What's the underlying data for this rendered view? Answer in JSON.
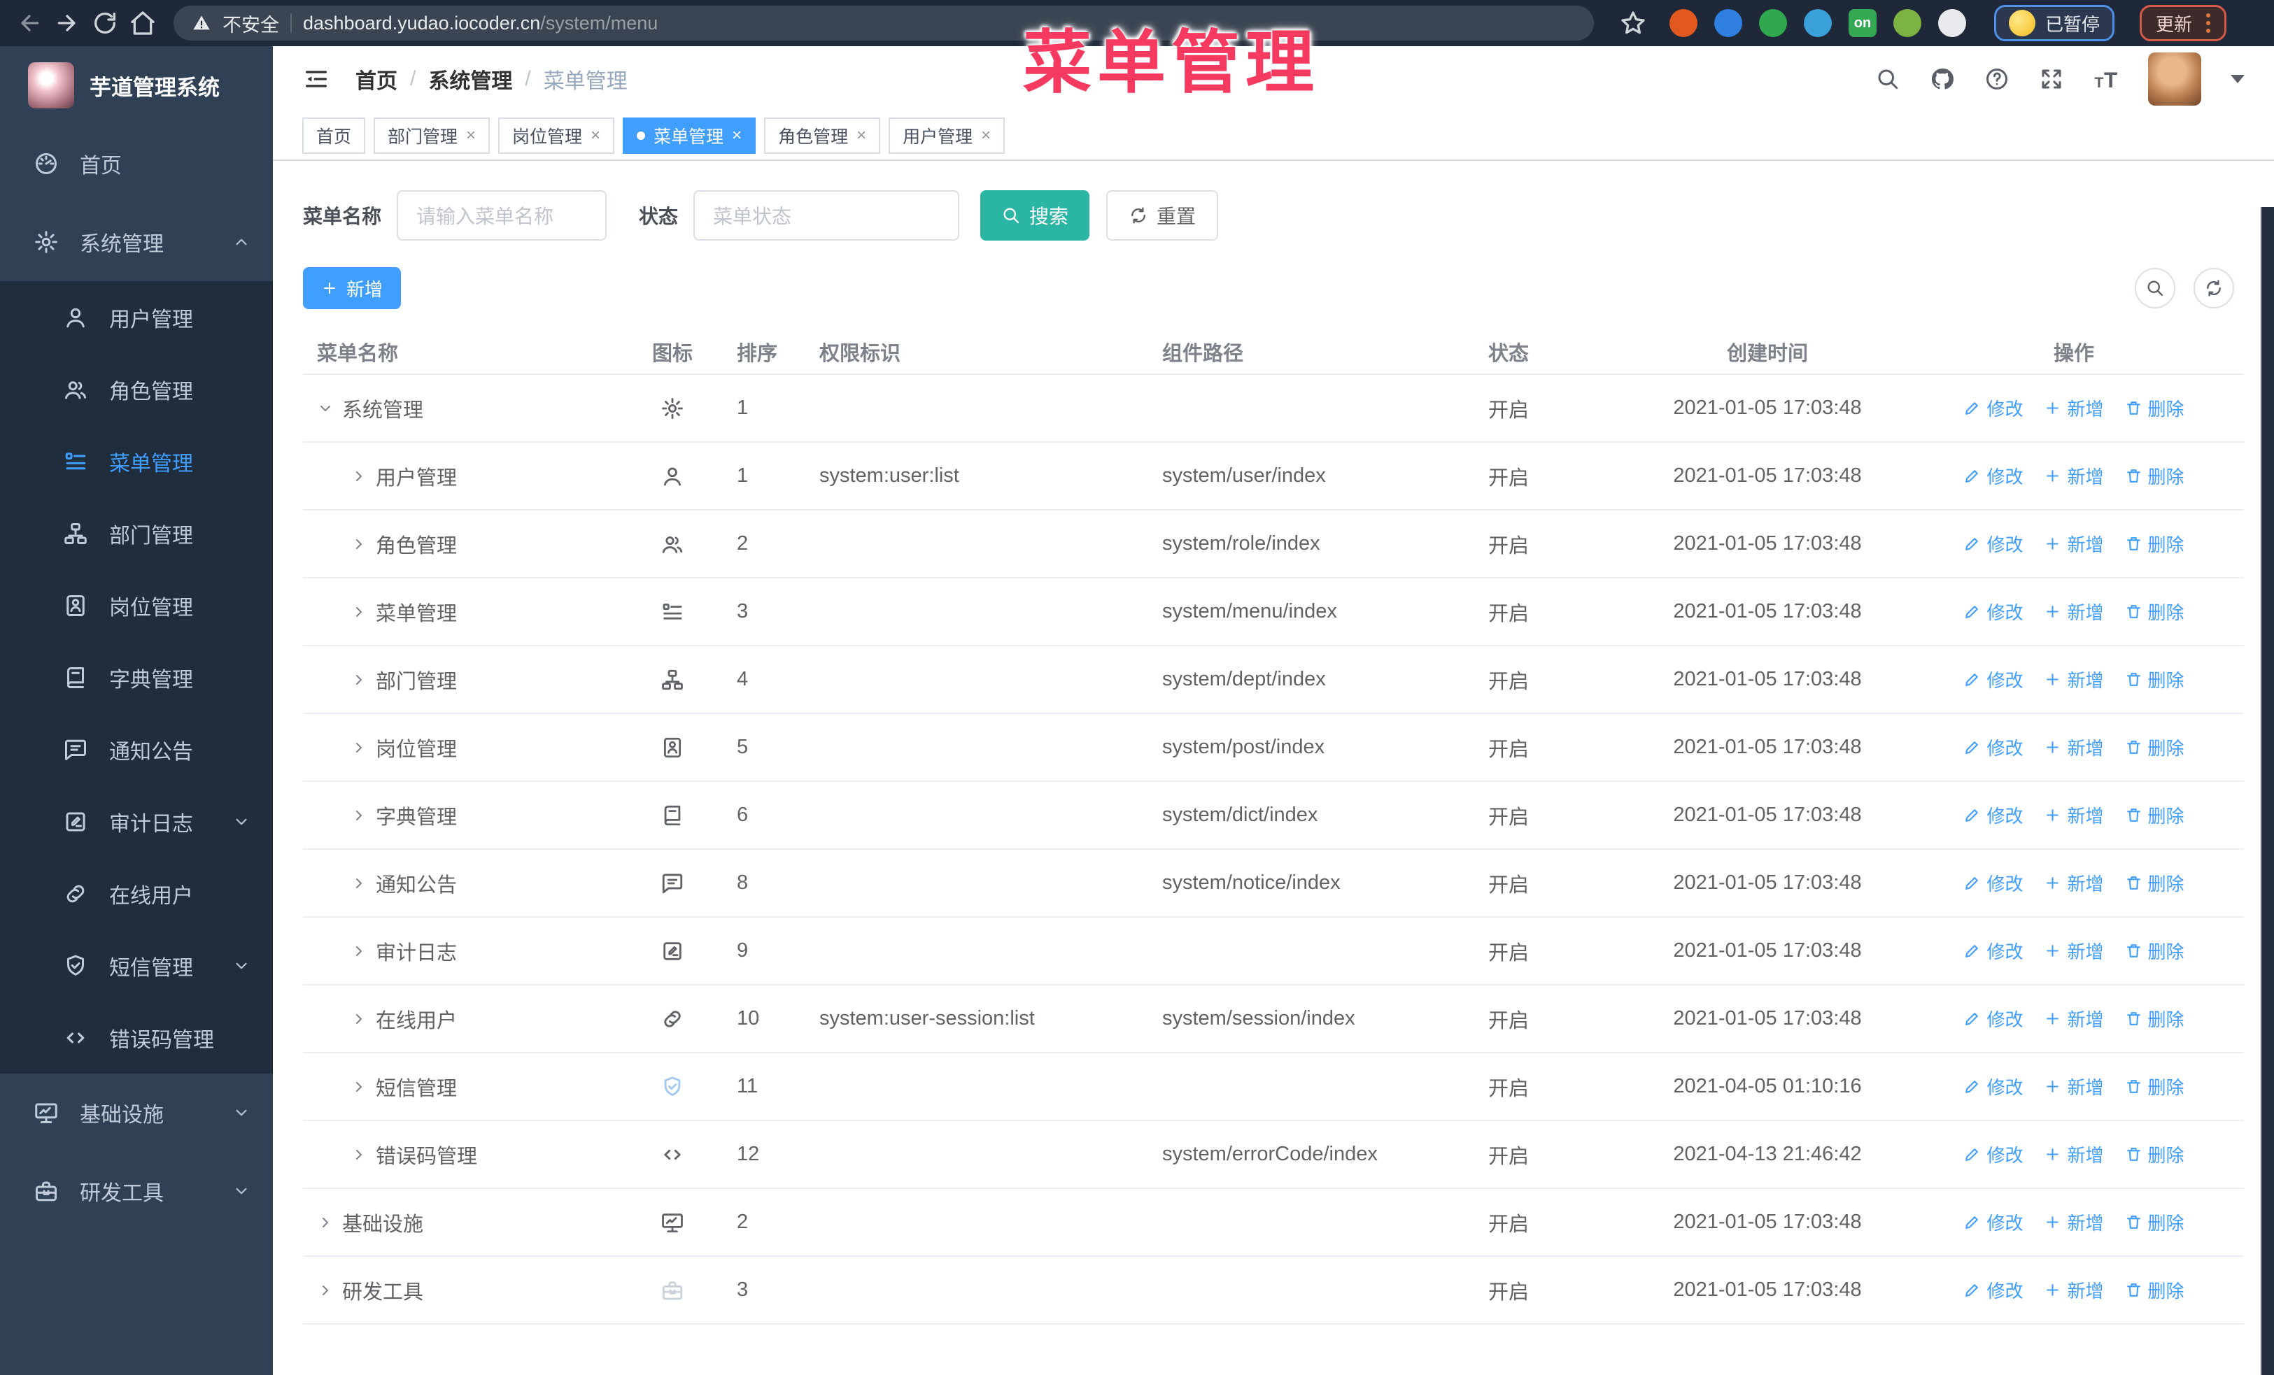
{
  "colors": {
    "accent": "#409EFF",
    "search_button": "#2BB5A5",
    "annotation": "#F5395F",
    "sidebar_bg": "#304156",
    "submenu_bg": "#1F2D3D",
    "browser_bar_bg": "#1F2838"
  },
  "annotation": {
    "text": "菜单管理"
  },
  "browser": {
    "security_label": "不安全",
    "url_host": "dashboard.yudao.iocoder.cn",
    "url_path": "/system/menu",
    "paused_label": "已暂停",
    "update_label": "更新",
    "extensions": [
      {
        "name": "extension-orange-circle-icon",
        "color": "#e2591f"
      },
      {
        "name": "extension-blue-gem-icon",
        "color": "#2f7fe0"
      },
      {
        "name": "extension-green-check-icon",
        "color": "#2fa84f"
      },
      {
        "name": "extension-blue-grid-icon",
        "color": "#3aa0d8"
      },
      {
        "name": "extension-on-badge-icon",
        "color": "#34a853",
        "label": "on"
      },
      {
        "name": "extension-green-tool-icon",
        "color": "#7cb342"
      },
      {
        "name": "extension-white-puzzle-icon",
        "color": "#e8eaed"
      }
    ]
  },
  "sidebar": {
    "title": "芋道管理系统",
    "items": [
      {
        "key": "home",
        "label": "首页",
        "icon": "dashboard-icon",
        "type": "root"
      },
      {
        "key": "system-management",
        "label": "系统管理",
        "icon": "gear-icon",
        "type": "root",
        "chevron": "up"
      },
      {
        "key": "user-management",
        "label": "用户管理",
        "icon": "user-icon",
        "type": "child"
      },
      {
        "key": "role-management",
        "label": "角色管理",
        "icon": "users-icon",
        "type": "child"
      },
      {
        "key": "menu-management",
        "label": "菜单管理",
        "icon": "menu-list-icon",
        "type": "child",
        "active": true
      },
      {
        "key": "dept-management",
        "label": "部门管理",
        "icon": "org-tree-icon",
        "type": "child"
      },
      {
        "key": "post-management",
        "label": "岗位管理",
        "icon": "id-badge-icon",
        "type": "child"
      },
      {
        "key": "dict-management",
        "label": "字典管理",
        "icon": "book-icon",
        "type": "child"
      },
      {
        "key": "notice",
        "label": "通知公告",
        "icon": "message-icon",
        "type": "child"
      },
      {
        "key": "audit-log",
        "label": "审计日志",
        "icon": "edit-note-icon",
        "type": "child",
        "chevron": "down"
      },
      {
        "key": "online-user",
        "label": "在线用户",
        "icon": "link-icon",
        "type": "child"
      },
      {
        "key": "sms-management",
        "label": "短信管理",
        "icon": "shield-check-icon",
        "type": "child",
        "chevron": "down"
      },
      {
        "key": "error-code",
        "label": "错误码管理",
        "icon": "code-icon",
        "type": "child"
      },
      {
        "key": "infrastructure",
        "label": "基础设施",
        "icon": "monitor-icon",
        "type": "root",
        "chevron": "down"
      },
      {
        "key": "dev-tools",
        "label": "研发工具",
        "icon": "toolbox-icon",
        "type": "root",
        "chevron": "down"
      }
    ]
  },
  "header": {
    "breadcrumb": [
      "首页",
      "系统管理",
      "菜单管理"
    ],
    "separator": "/"
  },
  "tabs": [
    {
      "key": "home",
      "label": "首页",
      "closable": false,
      "active": false
    },
    {
      "key": "dept",
      "label": "部门管理",
      "closable": true,
      "active": false
    },
    {
      "key": "post",
      "label": "岗位管理",
      "closable": true,
      "active": false
    },
    {
      "key": "menu",
      "label": "菜单管理",
      "closable": true,
      "active": true
    },
    {
      "key": "role",
      "label": "角色管理",
      "closable": true,
      "active": false
    },
    {
      "key": "user",
      "label": "用户管理",
      "closable": true,
      "active": false
    }
  ],
  "filters": {
    "name_label": "菜单名称",
    "name_placeholder": "请输入菜单名称",
    "status_label": "状态",
    "status_placeholder": "菜单状态",
    "search_label": "搜索",
    "reset_label": "重置"
  },
  "toolbar": {
    "add_label": "新增"
  },
  "table": {
    "columns": [
      "菜单名称",
      "图标",
      "排序",
      "权限标识",
      "组件路径",
      "状态",
      "创建时间",
      "操作"
    ],
    "ops": {
      "edit": "修改",
      "add": "新增",
      "delete": "删除"
    },
    "rows": [
      {
        "key": "system",
        "name": "系统管理",
        "icon": "gear-icon",
        "sort": "1",
        "perm": "",
        "path": "",
        "status": "开启",
        "time": "2021-01-05 17:03:48",
        "level": 0,
        "expanded": true
      },
      {
        "key": "user",
        "name": "用户管理",
        "icon": "user-icon",
        "sort": "1",
        "perm": "system:user:list",
        "path": "system/user/index",
        "status": "开启",
        "time": "2021-01-05 17:03:48",
        "level": 1
      },
      {
        "key": "role",
        "name": "角色管理",
        "icon": "users-icon",
        "sort": "2",
        "perm": "",
        "path": "system/role/index",
        "status": "开启",
        "time": "2021-01-05 17:03:48",
        "level": 1
      },
      {
        "key": "menu",
        "name": "菜单管理",
        "icon": "menu-list-icon",
        "sort": "3",
        "perm": "",
        "path": "system/menu/index",
        "status": "开启",
        "time": "2021-01-05 17:03:48",
        "level": 1
      },
      {
        "key": "dept",
        "name": "部门管理",
        "icon": "org-tree-icon",
        "sort": "4",
        "perm": "",
        "path": "system/dept/index",
        "status": "开启",
        "time": "2021-01-05 17:03:48",
        "level": 1
      },
      {
        "key": "post",
        "name": "岗位管理",
        "icon": "id-badge-icon",
        "sort": "5",
        "perm": "",
        "path": "system/post/index",
        "status": "开启",
        "time": "2021-01-05 17:03:48",
        "level": 1
      },
      {
        "key": "dict",
        "name": "字典管理",
        "icon": "book-icon",
        "sort": "6",
        "perm": "",
        "path": "system/dict/index",
        "status": "开启",
        "time": "2021-01-05 17:03:48",
        "level": 1
      },
      {
        "key": "notice",
        "name": "通知公告",
        "icon": "message-icon",
        "sort": "8",
        "perm": "",
        "path": "system/notice/index",
        "status": "开启",
        "time": "2021-01-05 17:03:48",
        "level": 1
      },
      {
        "key": "audit-log",
        "name": "审计日志",
        "icon": "edit-note-icon",
        "sort": "9",
        "perm": "",
        "path": "",
        "status": "开启",
        "time": "2021-01-05 17:03:48",
        "level": 1
      },
      {
        "key": "online-user",
        "name": "在线用户",
        "icon": "link-icon",
        "sort": "10",
        "perm": "system:user-session:list",
        "path": "system/session/index",
        "status": "开启",
        "time": "2021-01-05 17:03:48",
        "level": 1
      },
      {
        "key": "sms",
        "name": "短信管理",
        "icon": "shield-check-icon",
        "sort": "11",
        "perm": "",
        "path": "",
        "status": "开启",
        "time": "2021-04-05 01:10:16",
        "level": 1,
        "icon_color": "#a3c8ef"
      },
      {
        "key": "error-code",
        "name": "错误码管理",
        "icon": "code-icon",
        "sort": "12",
        "perm": "",
        "path": "system/errorCode/index",
        "status": "开启",
        "time": "2021-04-13 21:46:42",
        "level": 1
      },
      {
        "key": "infrastructure",
        "name": "基础设施",
        "icon": "monitor-icon",
        "sort": "2",
        "perm": "",
        "path": "",
        "status": "开启",
        "time": "2021-01-05 17:03:48",
        "level": 0
      },
      {
        "key": "dev-tools",
        "name": "研发工具",
        "icon": "toolbox-icon",
        "sort": "3",
        "perm": "",
        "path": "",
        "status": "开启",
        "time": "2021-01-05 17:03:48",
        "level": 0,
        "icon_color": "#c9d2da"
      }
    ]
  }
}
